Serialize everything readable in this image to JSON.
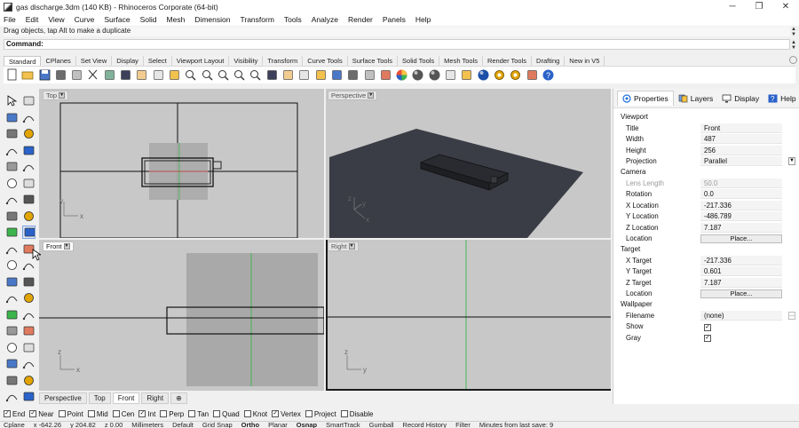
{
  "window": {
    "title": "gas discharge.3dm (140 KB) - Rhinoceros Corporate (64-bit)",
    "minimize": "─",
    "maximize": "❐",
    "close": "✕"
  },
  "menu": [
    "File",
    "Edit",
    "View",
    "Curve",
    "Surface",
    "Solid",
    "Mesh",
    "Dimension",
    "Transform",
    "Tools",
    "Analyze",
    "Render",
    "Panels",
    "Help"
  ],
  "command": {
    "history": "Drag objects, tap Alt to make a duplicate",
    "prompt": "Command:"
  },
  "toolbar_tabs": [
    "Standard",
    "CPlanes",
    "Set View",
    "Display",
    "Select",
    "Viewport Layout",
    "Visibility",
    "Transform",
    "Curve Tools",
    "Surface Tools",
    "Solid Tools",
    "Mesh Tools",
    "Render Tools",
    "Drafting",
    "New in V5"
  ],
  "toolbar_active": "Standard",
  "toolbar_icons": [
    "new-file-icon",
    "open-file-icon",
    "save-icon",
    "print-icon",
    "import-icon",
    "cut-icon",
    "copy-icon",
    "paste-icon",
    "undo-icon",
    "pan-icon",
    "rotate-view-icon",
    "zoom-icon",
    "zoom-window-icon",
    "zoom-extents-icon",
    "zoom-selected-icon",
    "zoom-dynamic-icon",
    "four-viewports-icon",
    "grid-icon",
    "cplane-icon",
    "curve-pt-icon",
    "point-icon",
    "light-icon",
    "lock-icon",
    "layer-icon",
    "color-wheel-icon",
    "shaded-icon",
    "rendered-icon",
    "render-icon",
    "sun-icon",
    "sphere-icon",
    "options-icon",
    "gear-icon",
    "pointer-icon",
    "help-icon"
  ],
  "viewports": {
    "top": {
      "label": "Top",
      "axis1": "x",
      "axis2": "y"
    },
    "perspective": {
      "label": "Perspective",
      "axis1": "x",
      "axis2": "y",
      "axis3": "z"
    },
    "front": {
      "label": "Front",
      "axis1": "x",
      "axis2": "z"
    },
    "right": {
      "label": "Right",
      "axis1": "y",
      "axis2": "z"
    }
  },
  "viewport_tabs": [
    "Perspective",
    "Top",
    "Front",
    "Right"
  ],
  "viewport_tab_active": "Front",
  "viewport_tab_add": "⊕",
  "osnaps": [
    {
      "label": "End",
      "checked": true
    },
    {
      "label": "Near",
      "checked": true
    },
    {
      "label": "Point",
      "checked": false
    },
    {
      "label": "Mid",
      "checked": false
    },
    {
      "label": "Cen",
      "checked": false
    },
    {
      "label": "Int",
      "checked": true
    },
    {
      "label": "Perp",
      "checked": false
    },
    {
      "label": "Tan",
      "checked": false
    },
    {
      "label": "Quad",
      "checked": false
    },
    {
      "label": "Knot",
      "checked": false
    },
    {
      "label": "Vertex",
      "checked": true
    },
    {
      "label": "Project",
      "checked": false
    },
    {
      "label": "Disable",
      "checked": false
    }
  ],
  "status": {
    "cplane": "Cplane",
    "x": "x -642.26",
    "y": "y 204.82",
    "z": "z 0.00",
    "units": "Millimeters",
    "layer": "Default",
    "items": [
      "Grid Snap",
      "Ortho",
      "Planar",
      "Osnap",
      "SmartTrack",
      "Gumball",
      "Record History",
      "Filter",
      "Minutes from last save: 9"
    ]
  },
  "panel": {
    "tabs": [
      {
        "label": "Properties",
        "icon": "properties-icon"
      },
      {
        "label": "Layers",
        "icon": "layers-icon"
      },
      {
        "label": "Display",
        "icon": "display-icon"
      },
      {
        "label": "Help",
        "icon": "help-icon"
      }
    ],
    "sections": {
      "viewport": "Viewport",
      "camera": "Camera",
      "target": "Target",
      "wallpaper": "Wallpaper"
    },
    "viewport": {
      "title_k": "Title",
      "title_v": "Front",
      "width_k": "Width",
      "width_v": "487",
      "height_k": "Height",
      "height_v": "256",
      "projection_k": "Projection",
      "projection_v": "Parallel"
    },
    "camera": {
      "lens_k": "Lens Length",
      "lens_v": "50.0",
      "rotation_k": "Rotation",
      "rotation_v": "0.0",
      "xloc_k": "X Location",
      "xloc_v": "-217.336",
      "yloc_k": "Y Location",
      "yloc_v": "-486.789",
      "zloc_k": "Z Location",
      "zloc_v": "7.187",
      "loc_k": "Location",
      "loc_btn": "Place..."
    },
    "target": {
      "x_k": "X Target",
      "x_v": "-217.336",
      "y_k": "Y Target",
      "y_v": "0.601",
      "z_k": "Z Target",
      "z_v": "7.187",
      "loc_k": "Location",
      "loc_btn": "Place..."
    },
    "wallpaper": {
      "file_k": "Filename",
      "file_v": "(none)",
      "show_k": "Show",
      "gray_k": "Gray"
    }
  },
  "colors": {
    "accent": "#1e6fd9",
    "viewport_bg": "#c8c8c8",
    "grid": "#b4b4b4",
    "green_axis": "#3cb44b",
    "red_axis": "#cc3333"
  }
}
